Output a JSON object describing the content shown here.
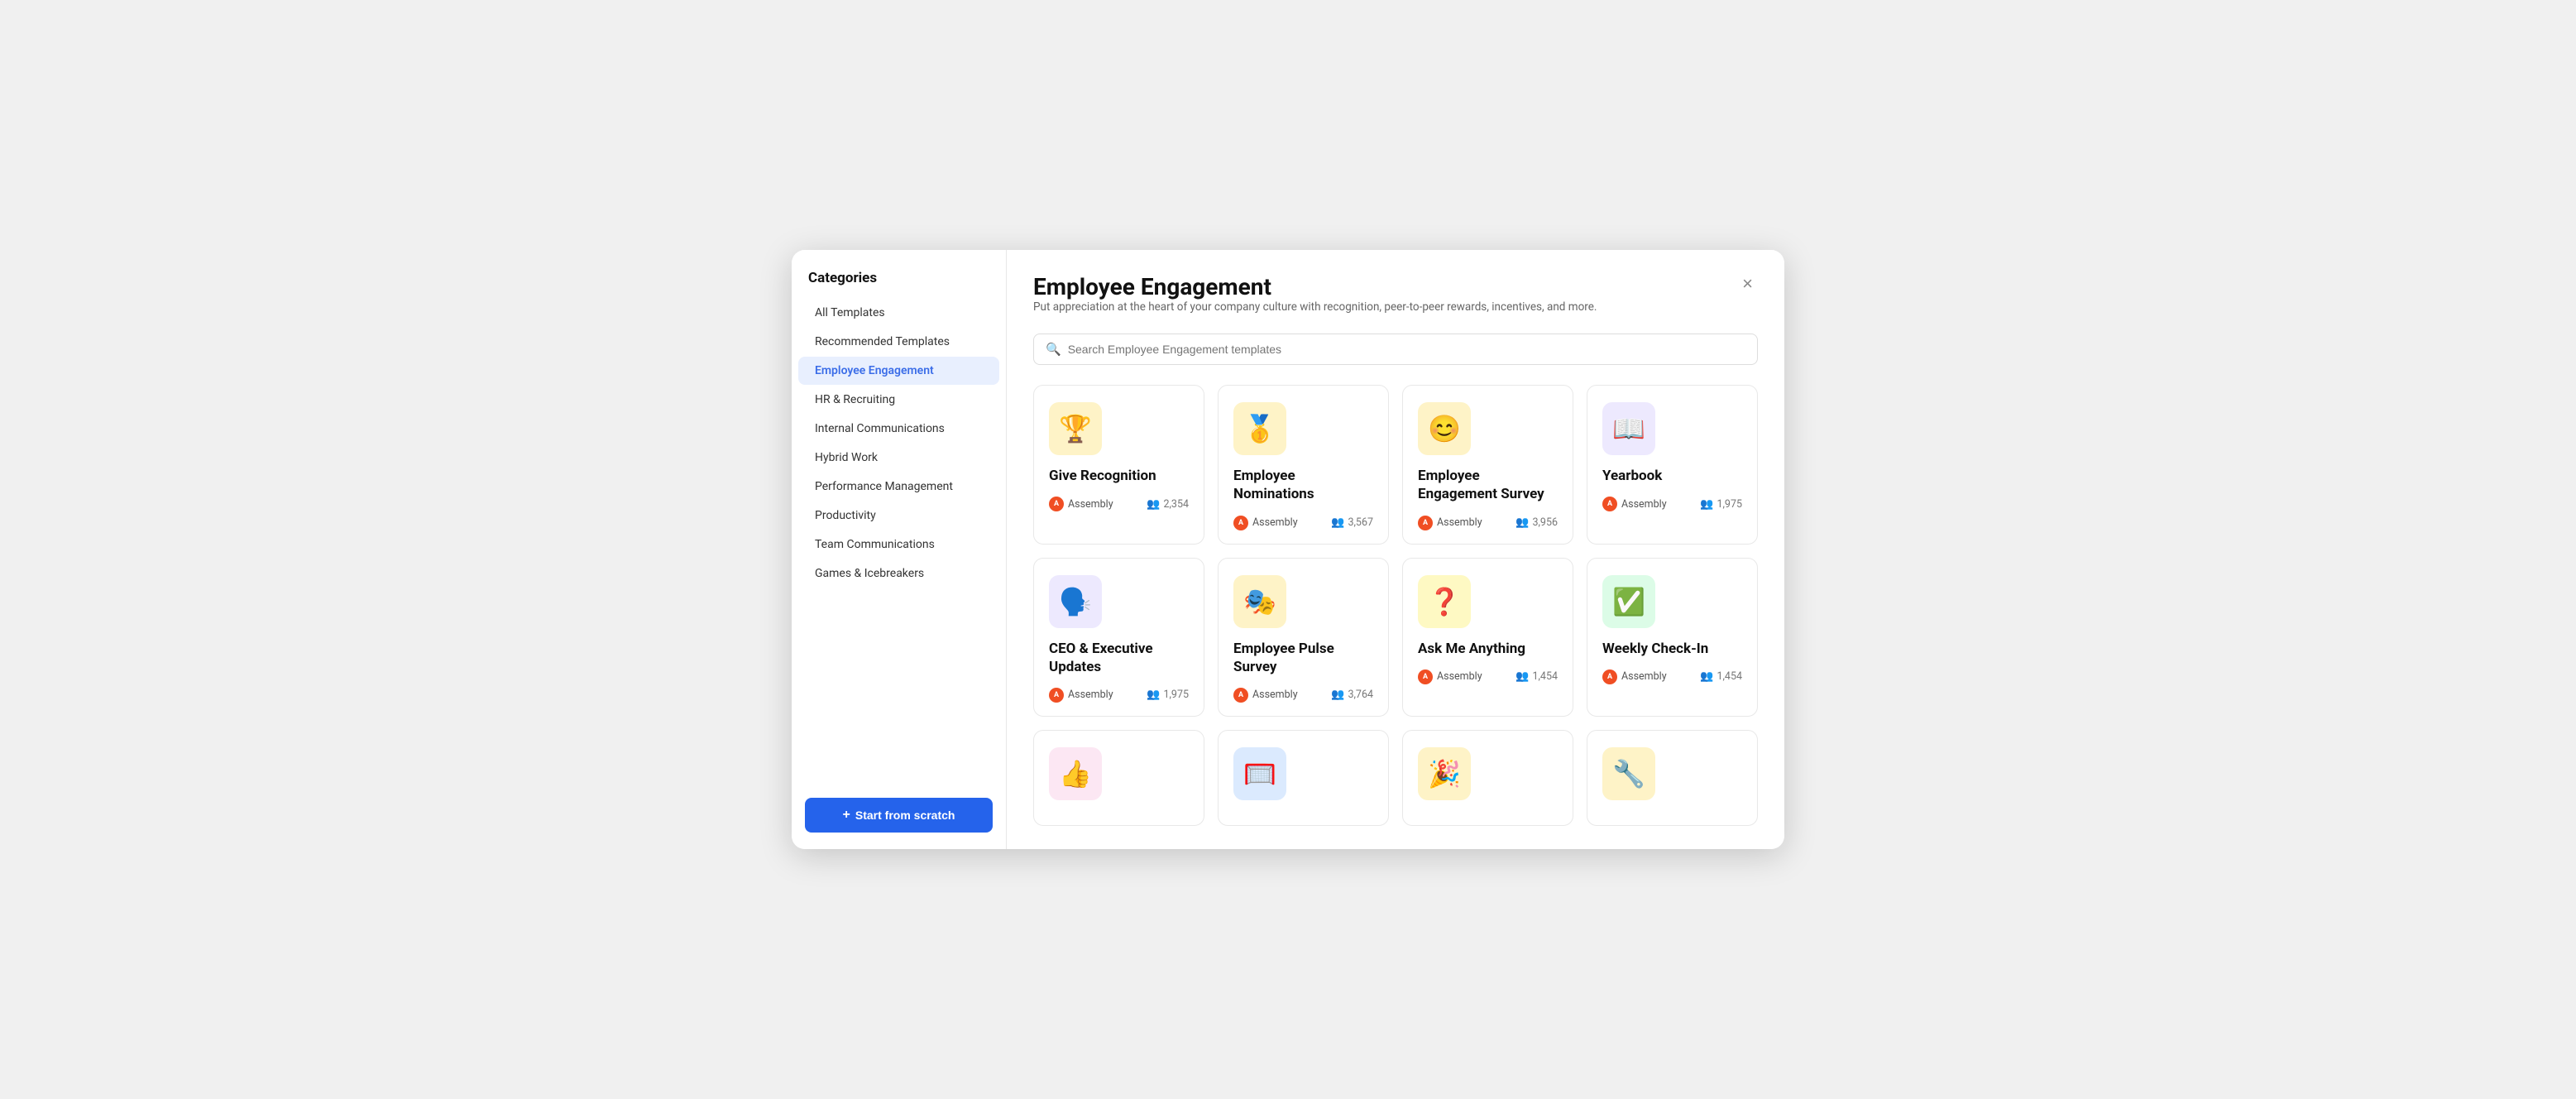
{
  "modal": {
    "close_label": "×"
  },
  "sidebar": {
    "title": "Categories",
    "items": [
      {
        "id": "all-templates",
        "label": "All Templates",
        "active": false
      },
      {
        "id": "recommended-templates",
        "label": "Recommended Templates",
        "active": false
      },
      {
        "id": "employee-engagement",
        "label": "Employee Engagement",
        "active": true
      },
      {
        "id": "hr-recruiting",
        "label": "HR & Recruiting",
        "active": false
      },
      {
        "id": "internal-communications",
        "label": "Internal Communications",
        "active": false
      },
      {
        "id": "hybrid-work",
        "label": "Hybrid Work",
        "active": false
      },
      {
        "id": "performance-management",
        "label": "Performance Management",
        "active": false
      },
      {
        "id": "productivity",
        "label": "Productivity",
        "active": false
      },
      {
        "id": "team-communications",
        "label": "Team Communications",
        "active": false
      },
      {
        "id": "games-icebreakers",
        "label": "Games & Icebreakers",
        "active": false
      }
    ],
    "start_from_scratch_label": "Start from scratch"
  },
  "main": {
    "title": "Employee Engagement",
    "subtitle": "Put appreciation at the heart of your company culture with recognition, peer-to-peer rewards, incentives, and more.",
    "search_placeholder": "Search Employee Engagement templates",
    "provider": "Assembly",
    "templates": [
      {
        "id": "give-recognition",
        "name": "Give Recognition",
        "icon": "🏆",
        "icon_bg": "#fef3c7",
        "count": "2,354"
      },
      {
        "id": "employee-nominations",
        "name": "Employee Nominations",
        "icon": "🥇",
        "icon_bg": "#fef3c7",
        "count": "3,567"
      },
      {
        "id": "employee-engagement-survey",
        "name": "Employee Engagement Survey",
        "icon": "😊",
        "icon_bg": "#fef3c7",
        "count": "3,956"
      },
      {
        "id": "yearbook",
        "name": "Yearbook",
        "icon": "📖",
        "icon_bg": "#ede9fe",
        "count": "1,975"
      },
      {
        "id": "ceo-executive-updates",
        "name": "CEO & Executive Updates",
        "icon": "🗣️",
        "icon_bg": "#ede9fe",
        "count": "1,975"
      },
      {
        "id": "employee-pulse-survey",
        "name": "Employee Pulse Survey",
        "icon": "🎭",
        "icon_bg": "#fef3c7",
        "count": "3,764"
      },
      {
        "id": "ask-me-anything",
        "name": "Ask Me Anything",
        "icon": "❓",
        "icon_bg": "#fef9c3",
        "count": "1,454"
      },
      {
        "id": "weekly-check-in",
        "name": "Weekly Check-In",
        "icon": "✅",
        "icon_bg": "#dcfce7",
        "count": "1,454"
      },
      {
        "id": "partial-1",
        "name": "",
        "icon": "👍",
        "icon_bg": "#fce7f3",
        "count": "",
        "partial": true
      },
      {
        "id": "partial-2",
        "name": "",
        "icon": "🥅",
        "icon_bg": "#dbeafe",
        "count": "",
        "partial": true
      },
      {
        "id": "partial-3",
        "name": "",
        "icon": "🎉",
        "icon_bg": "#fef3c7",
        "count": "",
        "partial": true
      },
      {
        "id": "partial-4",
        "name": "",
        "icon": "🔧",
        "icon_bg": "#fef3c7",
        "count": "",
        "partial": true
      }
    ]
  }
}
